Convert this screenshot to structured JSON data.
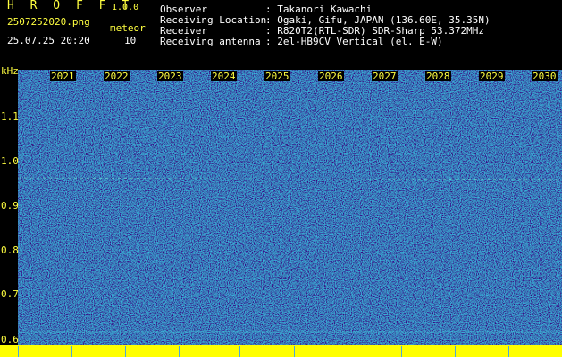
{
  "app": {
    "title": "H R O F F T",
    "version": "1.0.0"
  },
  "file": {
    "name": "2507252020.png",
    "datetime": "25.07.25 20:20"
  },
  "meteor": {
    "label": "meteor",
    "count": "10"
  },
  "info": [
    {
      "key": "Observer",
      "value": ": Takanori Kawachi"
    },
    {
      "key": "Receiving Location",
      "value": ": Ogaki, Gifu, JAPAN (136.60E, 35.35N)"
    },
    {
      "key": "Receiver",
      "value": ": R820T2(RTL-SDR) SDR-Sharp 53.372MHz"
    },
    {
      "key": "Receiving antenna",
      "value": ": 2el-HB9CV Vertical (el. E-W)"
    }
  ],
  "axis": {
    "unit": "kHz",
    "ticks": [
      "1.1",
      "1.0",
      "0.9",
      "0.8",
      "0.7",
      "0.6"
    ]
  },
  "years": [
    "2021",
    "2022",
    "2023",
    "2024",
    "2025",
    "2026",
    "2027",
    "2028",
    "2029",
    "2030"
  ],
  "colors": {
    "text": "#ffff40",
    "header": "#ffffff",
    "spectrum_bg": "#1a3fa8",
    "floor": "#ffff00"
  }
}
